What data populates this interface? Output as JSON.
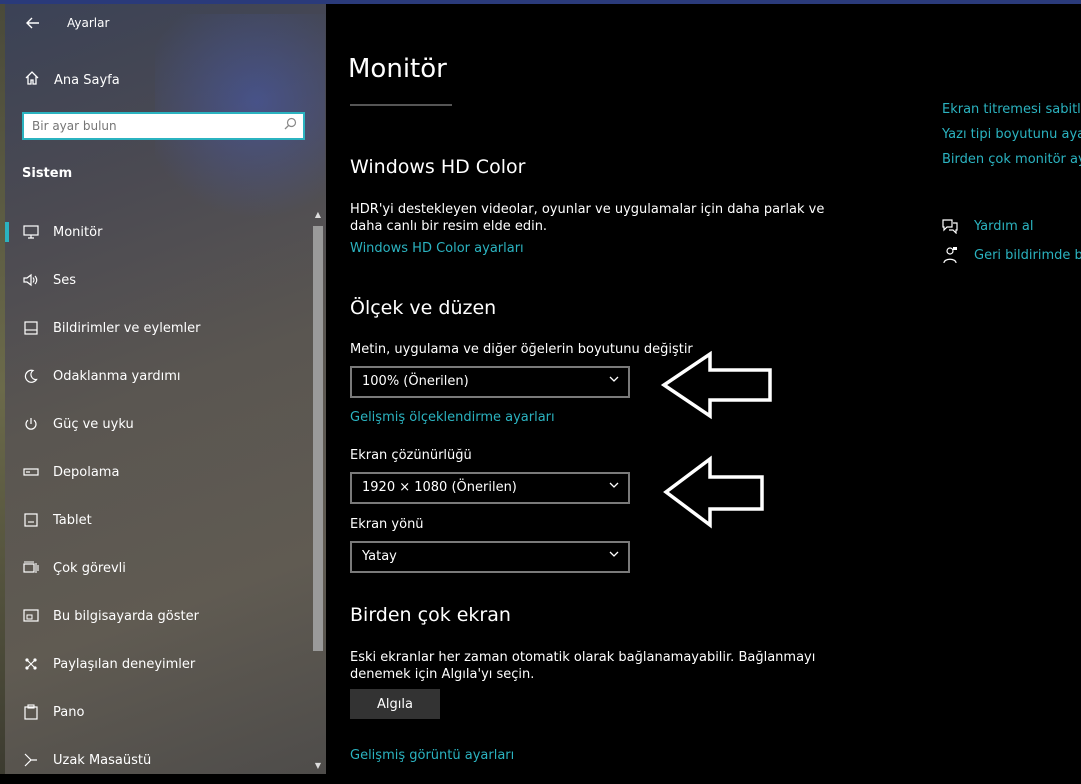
{
  "window": {
    "title": "Ayarlar"
  },
  "sidebar": {
    "home_label": "Ana Sayfa",
    "search_placeholder": "Bir ayar bulun",
    "section_label": "Sistem",
    "items": [
      {
        "label": "Monitör",
        "icon": "monitor-icon",
        "active": true
      },
      {
        "label": "Ses",
        "icon": "speaker-icon"
      },
      {
        "label": "Bildirimler ve eylemler",
        "icon": "notifications-icon"
      },
      {
        "label": "Odaklanma yardımı",
        "icon": "moon-icon"
      },
      {
        "label": "Güç ve uyku",
        "icon": "power-icon"
      },
      {
        "label": "Depolama",
        "icon": "storage-icon"
      },
      {
        "label": "Tablet",
        "icon": "tablet-icon"
      },
      {
        "label": "Çok görevli",
        "icon": "multitasking-icon"
      },
      {
        "label": "Bu bilgisayarda göster",
        "icon": "project-icon"
      },
      {
        "label": "Paylaşılan deneyimler",
        "icon": "share-icon"
      },
      {
        "label": "Pano",
        "icon": "clipboard-icon"
      },
      {
        "label": "Uzak Masaüstü",
        "icon": "remote-desktop-icon"
      }
    ]
  },
  "main": {
    "title": "Monitör",
    "hdr": {
      "heading": "Windows HD Color",
      "description_line1": "HDR'yi destekleyen videolar, oyunlar ve uygulamalar için daha parlak ve",
      "description_line2": "daha canlı bir resim elde edin.",
      "link": "Windows HD Color ayarları"
    },
    "scale": {
      "heading": "Ölçek ve düzen",
      "size_label": "Metin, uygulama ve diğer öğelerin boyutunu değiştir",
      "size_value": "100% (Önerilen)",
      "advanced_link": "Gelişmiş ölçeklendirme ayarları",
      "resolution_label": "Ekran çözünürlüğü",
      "resolution_value": "1920 × 1080 (Önerilen)",
      "orientation_label": "Ekran yönü",
      "orientation_value": "Yatay"
    },
    "multi": {
      "heading": "Birden çok ekran",
      "description_line1": "Eski ekranlar her zaman otomatik olarak bağlanamayabilir. Bağlanmayı",
      "description_line2": "denemek için Algıla'yı seçin.",
      "detect_button": "Algıla",
      "advanced_display_link": "Gelişmiş görüntü ayarları"
    }
  },
  "related": {
    "links": [
      "Ekran titremesi sabitle",
      "Yazı tipi boyutunu aya",
      "Birden çok monitör aya"
    ],
    "help_label": "Yardım al",
    "feedback_label": "Geri bildirimde bu"
  }
}
